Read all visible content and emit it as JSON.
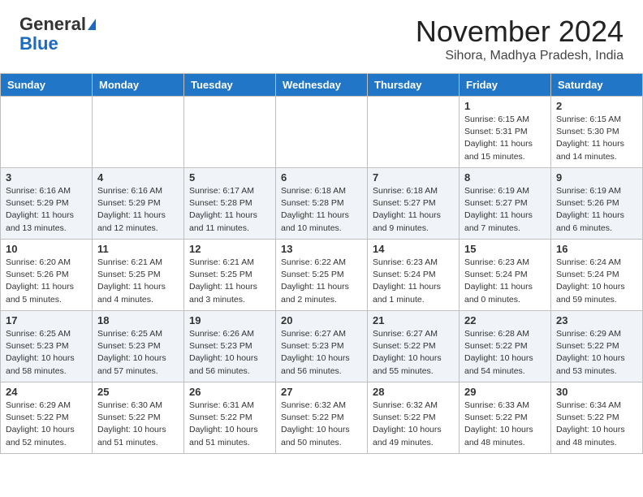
{
  "header": {
    "logo_general": "General",
    "logo_blue": "Blue",
    "month_title": "November 2024",
    "location": "Sihora, Madhya Pradesh, India"
  },
  "days_of_week": [
    "Sunday",
    "Monday",
    "Tuesday",
    "Wednesday",
    "Thursday",
    "Friday",
    "Saturday"
  ],
  "weeks": [
    [
      {
        "day": "",
        "info": ""
      },
      {
        "day": "",
        "info": ""
      },
      {
        "day": "",
        "info": ""
      },
      {
        "day": "",
        "info": ""
      },
      {
        "day": "",
        "info": ""
      },
      {
        "day": "1",
        "info": "Sunrise: 6:15 AM\nSunset: 5:31 PM\nDaylight: 11 hours and 15 minutes."
      },
      {
        "day": "2",
        "info": "Sunrise: 6:15 AM\nSunset: 5:30 PM\nDaylight: 11 hours and 14 minutes."
      }
    ],
    [
      {
        "day": "3",
        "info": "Sunrise: 6:16 AM\nSunset: 5:29 PM\nDaylight: 11 hours and 13 minutes."
      },
      {
        "day": "4",
        "info": "Sunrise: 6:16 AM\nSunset: 5:29 PM\nDaylight: 11 hours and 12 minutes."
      },
      {
        "day": "5",
        "info": "Sunrise: 6:17 AM\nSunset: 5:28 PM\nDaylight: 11 hours and 11 minutes."
      },
      {
        "day": "6",
        "info": "Sunrise: 6:18 AM\nSunset: 5:28 PM\nDaylight: 11 hours and 10 minutes."
      },
      {
        "day": "7",
        "info": "Sunrise: 6:18 AM\nSunset: 5:27 PM\nDaylight: 11 hours and 9 minutes."
      },
      {
        "day": "8",
        "info": "Sunrise: 6:19 AM\nSunset: 5:27 PM\nDaylight: 11 hours and 7 minutes."
      },
      {
        "day": "9",
        "info": "Sunrise: 6:19 AM\nSunset: 5:26 PM\nDaylight: 11 hours and 6 minutes."
      }
    ],
    [
      {
        "day": "10",
        "info": "Sunrise: 6:20 AM\nSunset: 5:26 PM\nDaylight: 11 hours and 5 minutes."
      },
      {
        "day": "11",
        "info": "Sunrise: 6:21 AM\nSunset: 5:25 PM\nDaylight: 11 hours and 4 minutes."
      },
      {
        "day": "12",
        "info": "Sunrise: 6:21 AM\nSunset: 5:25 PM\nDaylight: 11 hours and 3 minutes."
      },
      {
        "day": "13",
        "info": "Sunrise: 6:22 AM\nSunset: 5:25 PM\nDaylight: 11 hours and 2 minutes."
      },
      {
        "day": "14",
        "info": "Sunrise: 6:23 AM\nSunset: 5:24 PM\nDaylight: 11 hours and 1 minute."
      },
      {
        "day": "15",
        "info": "Sunrise: 6:23 AM\nSunset: 5:24 PM\nDaylight: 11 hours and 0 minutes."
      },
      {
        "day": "16",
        "info": "Sunrise: 6:24 AM\nSunset: 5:24 PM\nDaylight: 10 hours and 59 minutes."
      }
    ],
    [
      {
        "day": "17",
        "info": "Sunrise: 6:25 AM\nSunset: 5:23 PM\nDaylight: 10 hours and 58 minutes."
      },
      {
        "day": "18",
        "info": "Sunrise: 6:25 AM\nSunset: 5:23 PM\nDaylight: 10 hours and 57 minutes."
      },
      {
        "day": "19",
        "info": "Sunrise: 6:26 AM\nSunset: 5:23 PM\nDaylight: 10 hours and 56 minutes."
      },
      {
        "day": "20",
        "info": "Sunrise: 6:27 AM\nSunset: 5:23 PM\nDaylight: 10 hours and 56 minutes."
      },
      {
        "day": "21",
        "info": "Sunrise: 6:27 AM\nSunset: 5:22 PM\nDaylight: 10 hours and 55 minutes."
      },
      {
        "day": "22",
        "info": "Sunrise: 6:28 AM\nSunset: 5:22 PM\nDaylight: 10 hours and 54 minutes."
      },
      {
        "day": "23",
        "info": "Sunrise: 6:29 AM\nSunset: 5:22 PM\nDaylight: 10 hours and 53 minutes."
      }
    ],
    [
      {
        "day": "24",
        "info": "Sunrise: 6:29 AM\nSunset: 5:22 PM\nDaylight: 10 hours and 52 minutes."
      },
      {
        "day": "25",
        "info": "Sunrise: 6:30 AM\nSunset: 5:22 PM\nDaylight: 10 hours and 51 minutes."
      },
      {
        "day": "26",
        "info": "Sunrise: 6:31 AM\nSunset: 5:22 PM\nDaylight: 10 hours and 51 minutes."
      },
      {
        "day": "27",
        "info": "Sunrise: 6:32 AM\nSunset: 5:22 PM\nDaylight: 10 hours and 50 minutes."
      },
      {
        "day": "28",
        "info": "Sunrise: 6:32 AM\nSunset: 5:22 PM\nDaylight: 10 hours and 49 minutes."
      },
      {
        "day": "29",
        "info": "Sunrise: 6:33 AM\nSunset: 5:22 PM\nDaylight: 10 hours and 48 minutes."
      },
      {
        "day": "30",
        "info": "Sunrise: 6:34 AM\nSunset: 5:22 PM\nDaylight: 10 hours and 48 minutes."
      }
    ]
  ]
}
